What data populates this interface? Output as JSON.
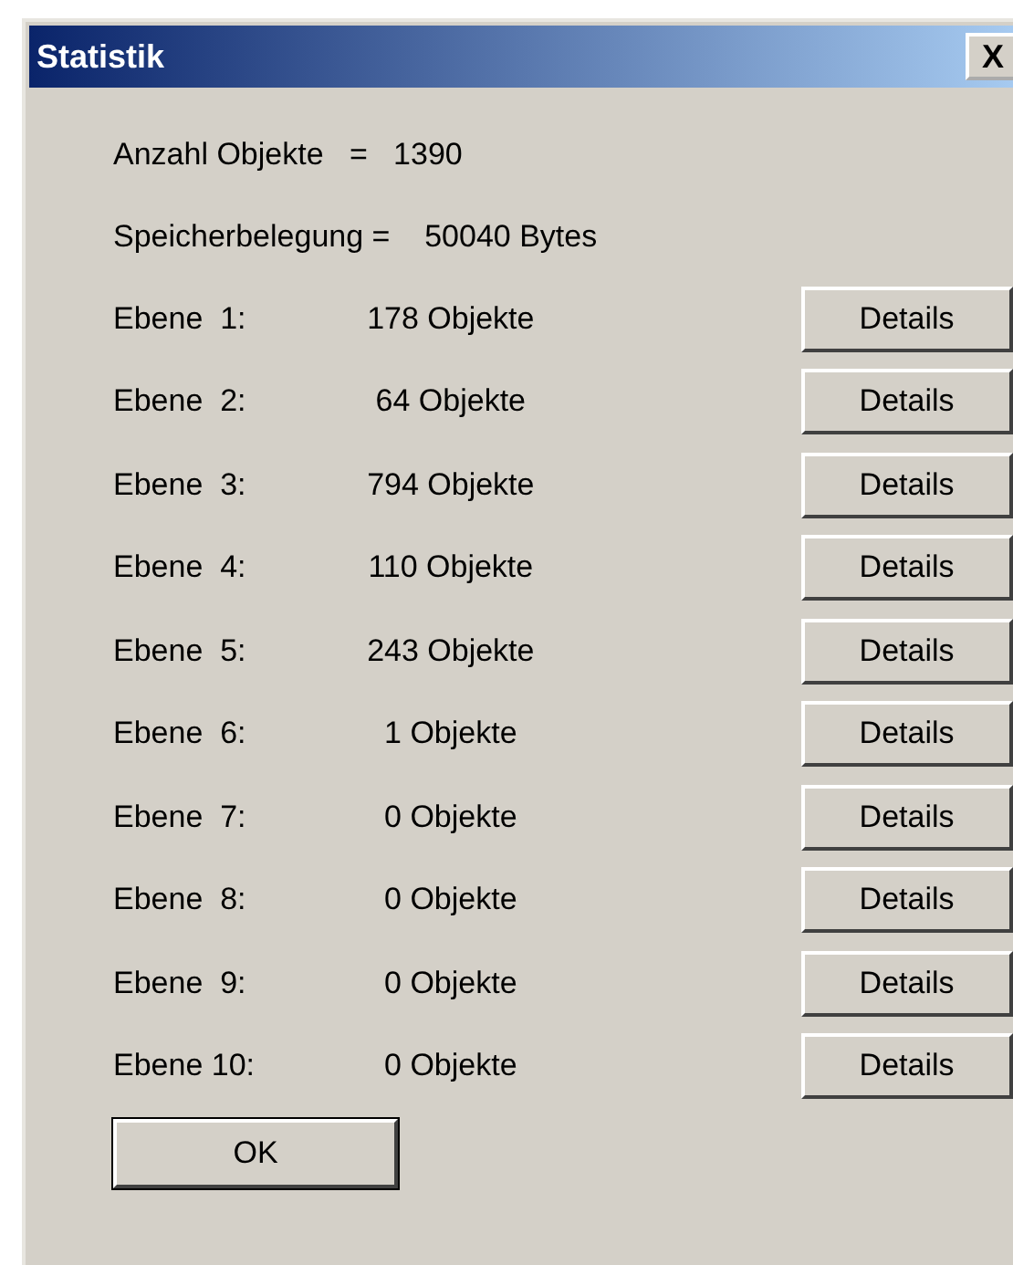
{
  "window": {
    "title": "Statistik",
    "close": "X"
  },
  "summary": [
    {
      "label": "Anzahl Objekte   =   1390"
    },
    {
      "label": "Speicherbelegung =    50040 Bytes"
    }
  ],
  "levels": [
    {
      "name": "Ebene  1:",
      "count": "178 Objekte",
      "button": "Details"
    },
    {
      "name": "Ebene  2:",
      "count": "64 Objekte",
      "button": "Details"
    },
    {
      "name": "Ebene  3:",
      "count": "794 Objekte",
      "button": "Details"
    },
    {
      "name": "Ebene  4:",
      "count": "110 Objekte",
      "button": "Details"
    },
    {
      "name": "Ebene  5:",
      "count": "243 Objekte",
      "button": "Details"
    },
    {
      "name": "Ebene  6:",
      "count": "1 Objekte",
      "button": "Details"
    },
    {
      "name": "Ebene  7:",
      "count": "0 Objekte",
      "button": "Details"
    },
    {
      "name": "Ebene  8:",
      "count": "0 Objekte",
      "button": "Details"
    },
    {
      "name": "Ebene  9:",
      "count": "0 Objekte",
      "button": "Details"
    },
    {
      "name": "Ebene 10:",
      "count": "0 Objekte",
      "button": "Details"
    }
  ],
  "buttons": [
    "OK"
  ]
}
